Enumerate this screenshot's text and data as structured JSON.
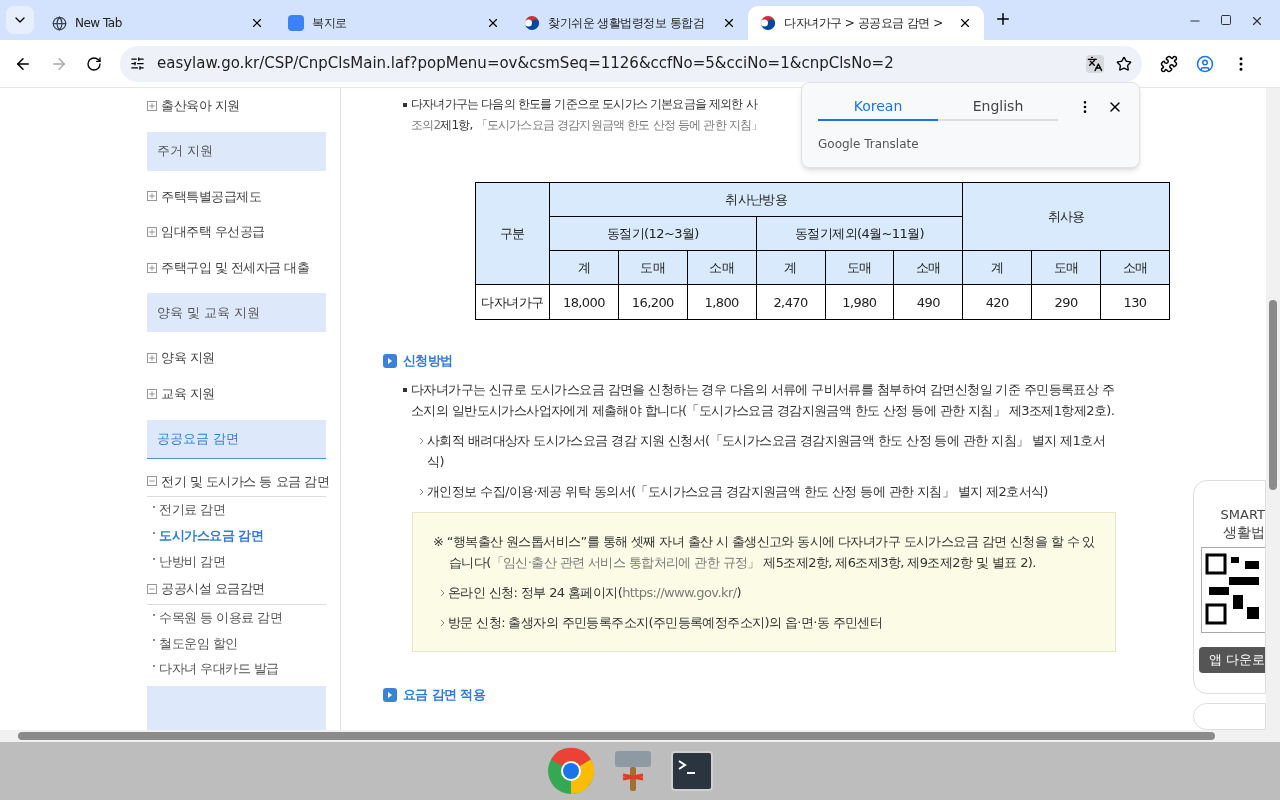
{
  "browser": {
    "tabs": [
      {
        "title": "New Tab",
        "selected": false,
        "kind": "newtab"
      },
      {
        "title": "복지로",
        "selected": false,
        "kind": "site"
      },
      {
        "title": "찾기쉬운 생활법령정보 통합검",
        "selected": false,
        "kind": "gov"
      },
      {
        "title": "다자녀가구 > 공공요금 감면 >",
        "selected": true,
        "kind": "gov"
      }
    ],
    "url": "easylaw.go.kr/CSP/CnpClsMain.laf?popMenu=ov&csmSeq=1126&ccfNo=5&cciNo=1&cnpClsNo=2"
  },
  "translate_popup": {
    "tabs": [
      {
        "label": "Korean",
        "selected": true
      },
      {
        "label": "English",
        "selected": false
      }
    ],
    "brand": "Google Translate"
  },
  "sidebar": {
    "items": [
      {
        "kind": "group",
        "label": "출산육아 지원",
        "expanded": false
      },
      {
        "kind": "header",
        "label": "주거 지원",
        "selected": false
      },
      {
        "kind": "group",
        "label": "주택특별공급제도",
        "expanded": false
      },
      {
        "kind": "group",
        "label": "임대주택 우선공급",
        "expanded": false
      },
      {
        "kind": "group",
        "label": "주택구입 및 전세자금 대출",
        "expanded": false
      },
      {
        "kind": "header",
        "label": "양육 및 교육 지원",
        "selected": false
      },
      {
        "kind": "group",
        "label": "양육 지원",
        "expanded": false
      },
      {
        "kind": "group",
        "label": "교육 지원",
        "expanded": false
      },
      {
        "kind": "header",
        "label": "공공요금 감면",
        "selected": true
      },
      {
        "kind": "group",
        "label": "전기 및 도시가스 등 요금 감면",
        "expanded": true
      },
      {
        "kind": "sub",
        "label": "전기료 감면",
        "selected": false
      },
      {
        "kind": "sub",
        "label": "도시가스요금 감면",
        "selected": true
      },
      {
        "kind": "sub",
        "label": "난방비 감면",
        "selected": false
      },
      {
        "kind": "group",
        "label": "공공시설 요금감면",
        "expanded": true
      },
      {
        "kind": "sub",
        "label": "수목원 등 이용료 감면",
        "selected": false
      },
      {
        "kind": "sub",
        "label": "철도운임 할인",
        "selected": false
      },
      {
        "kind": "sub",
        "label": "다자녀 우대카드 발급",
        "selected": false
      }
    ]
  },
  "intro": {
    "lines": [
      [
        {
          "text": "다자녀가구는 다음의 한도를 기준으로 도시가스 기본요금을 제외한 사",
          "muted": false
        }
      ],
      [
        {
          "text": "조의2",
          "muted": true
        },
        {
          "text": "제1항, ",
          "muted": false
        },
        {
          "text": "「도시가스요금 경감지원금액 한도 산정 등에 관한 지침」",
          "muted": true
        }
      ]
    ]
  },
  "table": {
    "corner": "구분",
    "groups": [
      {
        "label": "취사난방용",
        "subgroups": [
          {
            "label": "동절기(12~3월)",
            "columns": [
              "계",
              "도매",
              "소매"
            ]
          },
          {
            "label": "동절기제외(4월~11월)",
            "columns": [
              "계",
              "도매",
              "소매"
            ]
          }
        ]
      },
      {
        "label": "취사용",
        "columns": [
          "계",
          "도매",
          "소매"
        ]
      }
    ],
    "rows": [
      {
        "label": "다자녀가구",
        "cells": [
          "18,000",
          "16,200",
          "1,800",
          "2,470",
          "1,980",
          "490",
          "420",
          "290",
          "130"
        ]
      }
    ]
  },
  "sections": [
    {
      "title": "신청방법",
      "paragraph": [
        {
          "text": "다자녀가구는 신규로 도시가스요금 감면을 신청하는 경우 다음의 서류에 구비서류를 첨부하여 감면신청일 기준 주민등록표상 주소지의 일반도시가스사업자에게 제출해야 합니다(「도시가스요금 경감지원금액 한도 산정 등에 관한 지침」 제3조제1항제2호).",
          "muted": false
        }
      ],
      "items": [
        [
          {
            "text": "사회적 배려대상자 도시가스요금 경감 지원 신청서(「도시가스요금 경감지원금액 한도 산정 등에 관한 지침」 별지 제1호서식)",
            "muted": false
          }
        ],
        [
          {
            "text": "개인정보 수집/이용·제공 위탁 동의서(「도시가스요금 경감지원금액 한도 산정 등에 관한 지침」 별지 제2호서식)",
            "muted": false
          }
        ]
      ],
      "note": {
        "text": [
          {
            "text": "※ “행복출산 원스톱서비스”를 통해 셋째 자녀 출산 시 출생신고와 동시에 다자녀가구 도시가스요금 감면 신청을 할 수 있습니다(",
            "muted": false
          },
          {
            "text": "「임신·출산 관련 서비스 통합처리에 관한 규정」",
            "muted": true
          },
          {
            "text": " 제5조제2항, 제6조제3항, 제9조제2항 및 별표 2).",
            "muted": false
          }
        ],
        "items": [
          [
            {
              "text": "온라인 신청: 정부 24 홈페이지(",
              "muted": false
            },
            {
              "text": "https://www.gov.kr/",
              "muted": true
            },
            {
              "text": ")",
              "muted": false
            }
          ],
          [
            {
              "text": "방문 신청: 출생자의 주민등록주소지(주민등록예정주소지)의 읍·면·동 주민센터",
              "muted": false
            }
          ]
        ]
      }
    },
    {
      "title": "요금 감면 적용"
    }
  ],
  "app_widget": {
    "title": "SMART",
    "subtitle": "생활법",
    "button": "앱 다운로"
  }
}
